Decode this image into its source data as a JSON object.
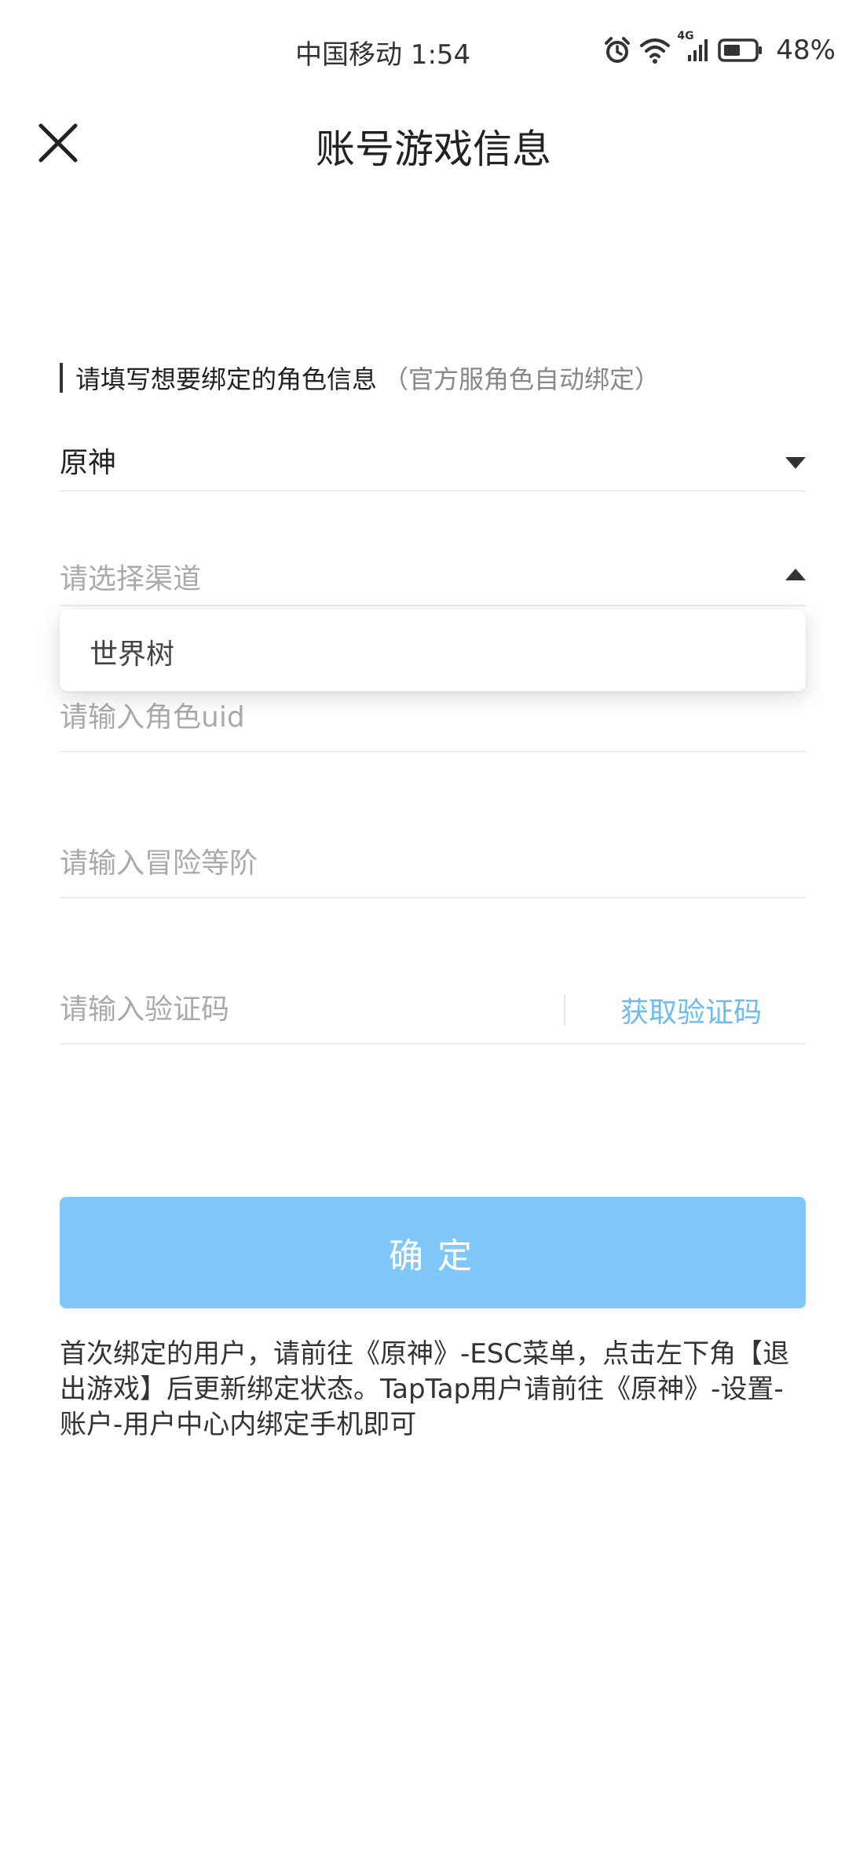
{
  "status_bar": {
    "carrier_time": "中国移动 1:54",
    "network_label": "4G",
    "battery_percent": "48%",
    "icons": [
      "alarm-icon",
      "wifi-icon",
      "cellular-signal-icon",
      "battery-icon"
    ]
  },
  "header": {
    "title": "账号游戏信息",
    "close_icon": "close-icon"
  },
  "form": {
    "section_label": "请填写想要绑定的角色信息",
    "section_hint": "（官方服角色自动绑定）",
    "game_select": {
      "value": "原神"
    },
    "channel_select": {
      "placeholder": "请选择渠道",
      "options": [
        "世界树"
      ]
    },
    "uid_input": {
      "placeholder": "请输入角色uid"
    },
    "rank_input": {
      "placeholder": "请输入冒险等阶"
    },
    "code_input": {
      "placeholder": "请输入验证码",
      "get_code_label": "获取验证码"
    },
    "confirm_label": "确定"
  },
  "note": "首次绑定的用户，请前往《原神》-ESC菜单，点击左下角【退出游戏】后更新绑定状态。TapTap用户请前往《原神》-设置-账户-用户中心内绑定手机即可",
  "colors": {
    "accent": "#80c8f9",
    "link": "#6cbcef",
    "placeholder": "#aaaaaa"
  }
}
